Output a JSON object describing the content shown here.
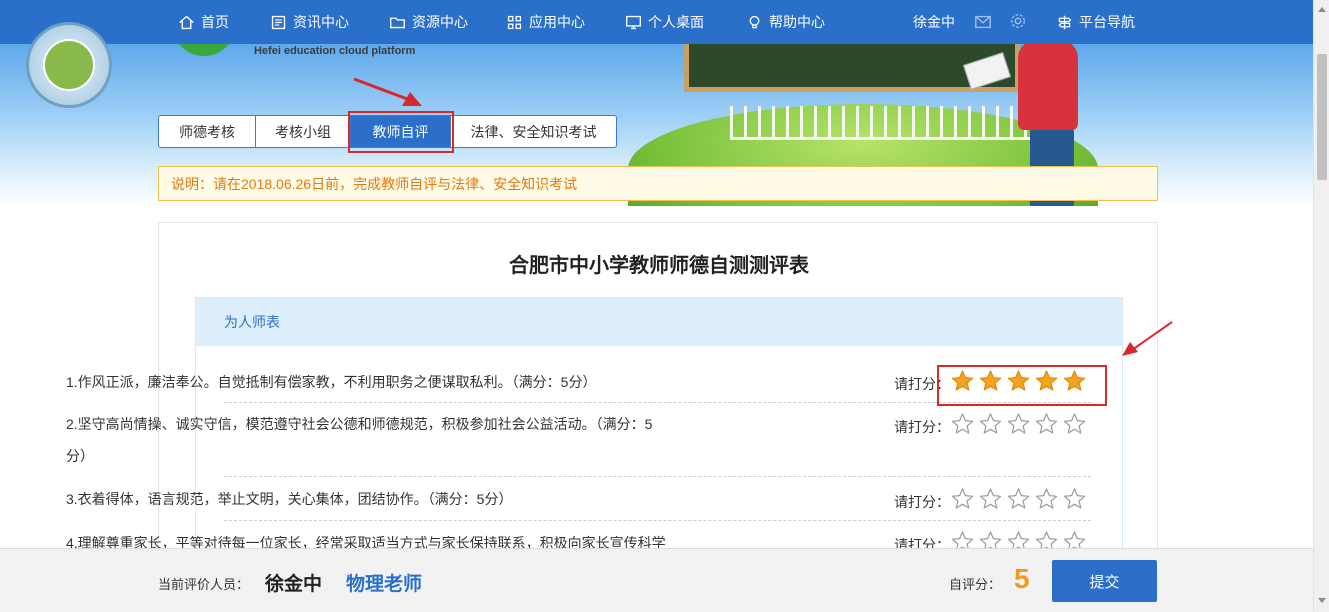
{
  "nav": {
    "items": [
      {
        "label": "首页",
        "icon": "home-icon"
      },
      {
        "label": "资讯中心",
        "icon": "news-icon"
      },
      {
        "label": "资源中心",
        "icon": "folder-icon"
      },
      {
        "label": "应用中心",
        "icon": "grid-icon"
      },
      {
        "label": "个人桌面",
        "icon": "monitor-icon"
      },
      {
        "label": "帮助中心",
        "icon": "lightbulb-icon"
      }
    ],
    "user": "徐金中",
    "platform_nav": "平台导航"
  },
  "banner": {
    "platform_text": "Hefei education cloud platform"
  },
  "tabs": [
    {
      "label": "师德考核",
      "active": false
    },
    {
      "label": "考核小组",
      "active": false
    },
    {
      "label": "教师自评",
      "active": true
    },
    {
      "label": "法律、安全知识考试",
      "active": false
    }
  ],
  "notice": "说明：请在2018.06.26日前，完成教师自评与法律、安全知识考试",
  "form": {
    "title": "合肥市中小学教师师德自测测评表",
    "section": "为人师表",
    "rate_label": "请打分：",
    "questions": [
      {
        "text": "1.作风正派，廉洁奉公。自觉抵制有偿家教，不利用职务之便谋取私利。（满分：5分）",
        "rating": 5,
        "max": 5
      },
      {
        "text": "2.坚守高尚情操、诚实守信，模范遵守社会公德和师德规范，积极参加社会公益活动。（满分：5分）",
        "rating": 0,
        "max": 5
      },
      {
        "text": "3.衣着得体，语言规范，举止文明，关心集体，团结协作。（满分：5分）",
        "rating": 0,
        "max": 5
      },
      {
        "text": "4.理解尊重家长，平等对待每一位家长，经常采取适当方式与家长保持联系，积极向家长宣传科学",
        "rating": 0,
        "max": 5
      }
    ]
  },
  "footer": {
    "evaluator_label": "当前评价人员：",
    "name": "徐金中",
    "role": "物理老师",
    "score_label": "自评分：",
    "score": "5",
    "submit": "提交"
  },
  "colors": {
    "nav_bg": "#2a6fc9",
    "accent": "#2b6fc8",
    "star": "#f4a41d",
    "annotation_red": "#d9272e",
    "notice_text": "#e07b11"
  }
}
